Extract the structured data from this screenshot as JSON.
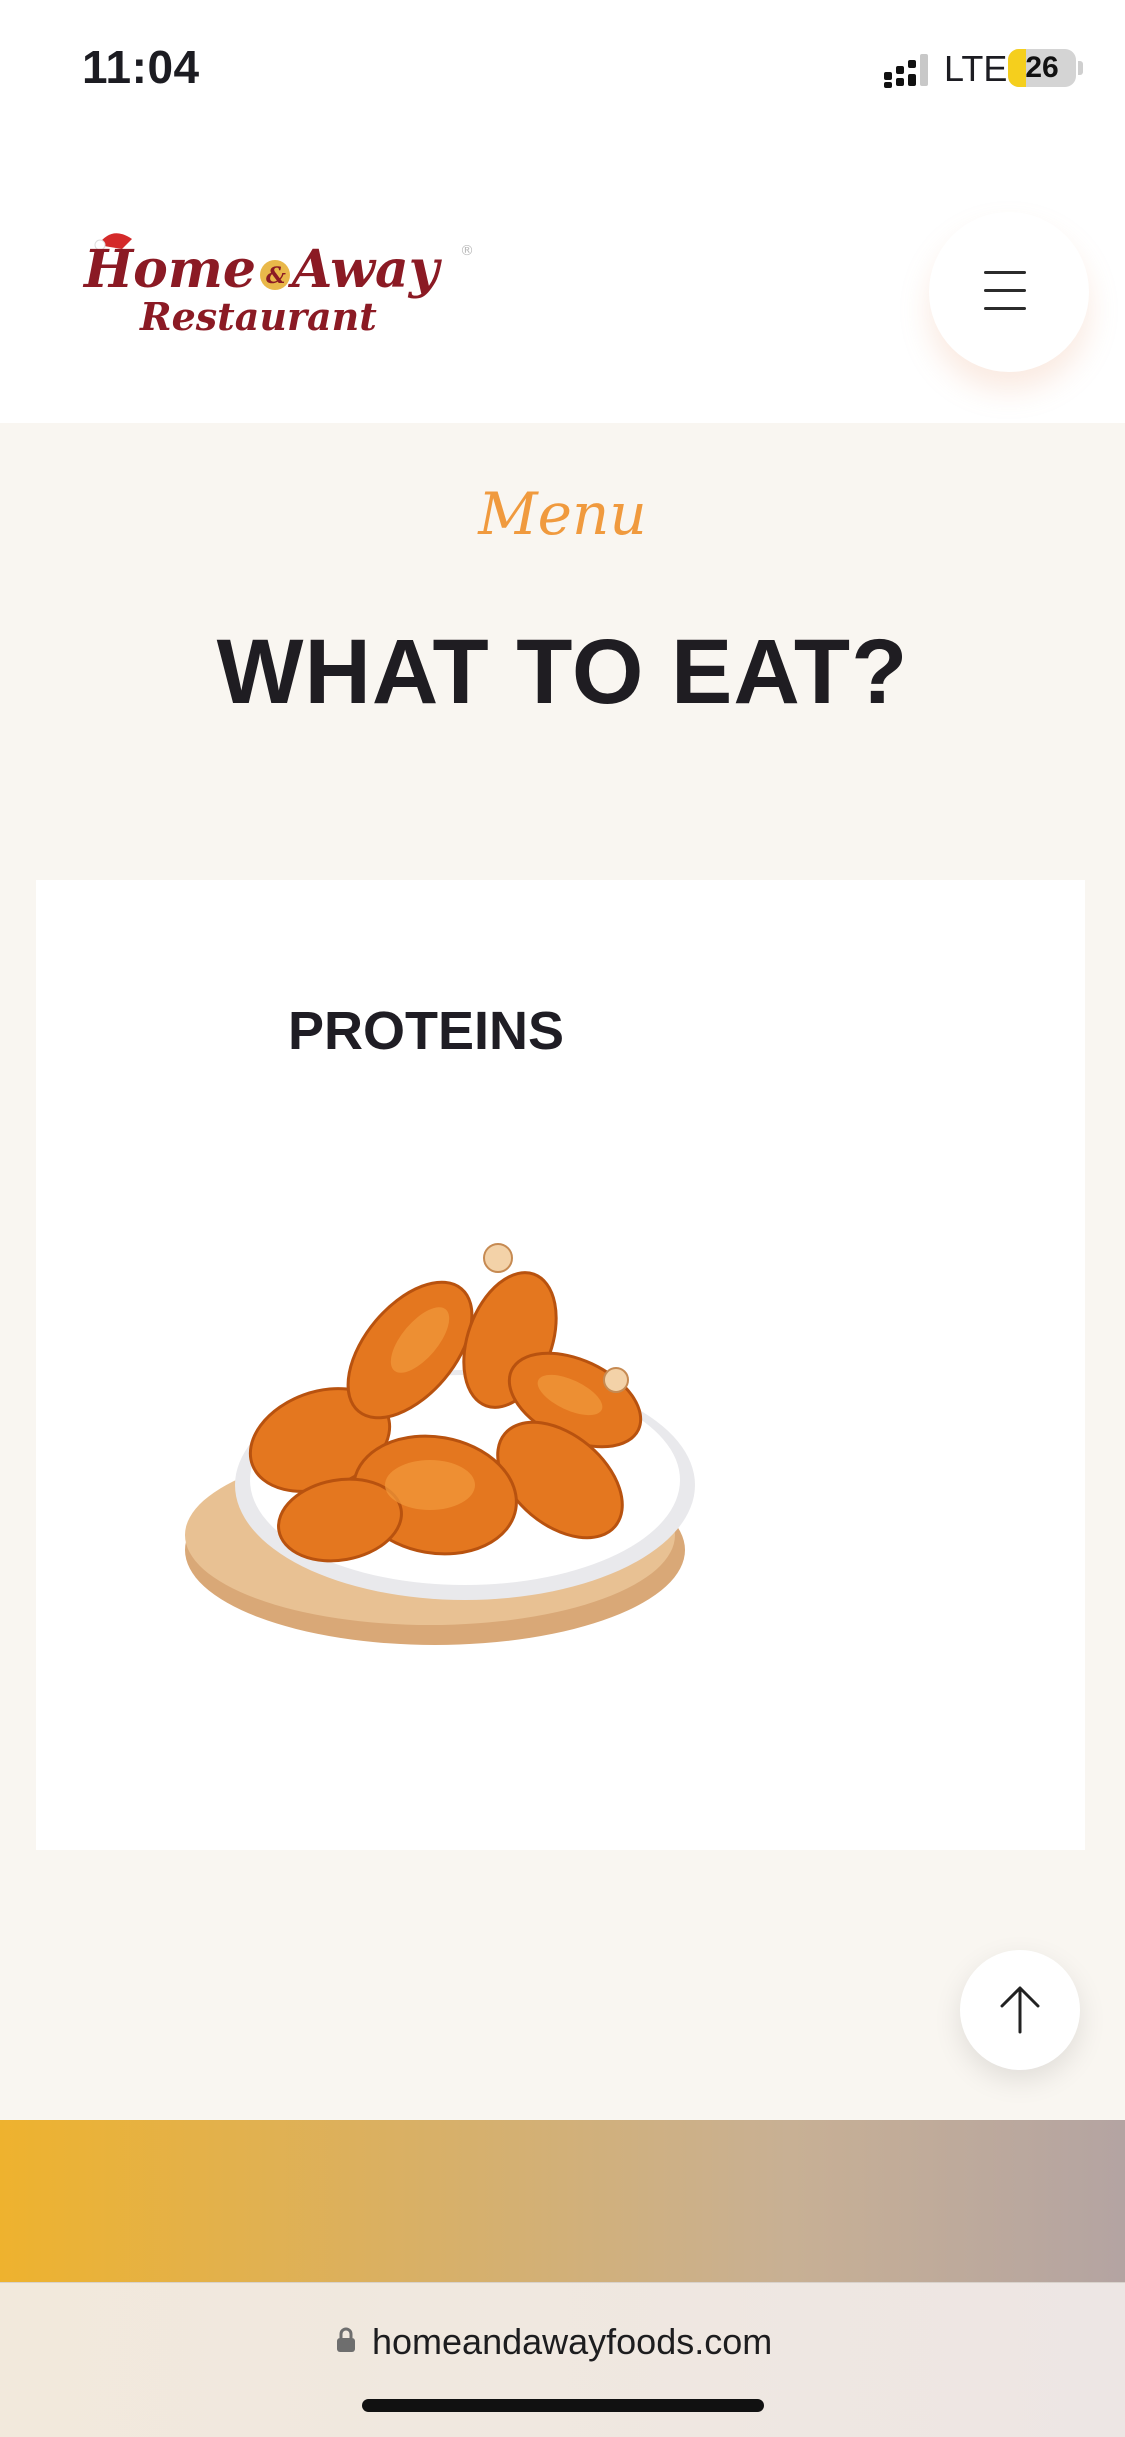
{
  "status_bar": {
    "time": "11:04",
    "network": "LTE",
    "battery": "26",
    "battery_level": 0.26
  },
  "header": {
    "logo": {
      "line1_a": "Home",
      "line1_amp": "&",
      "line1_b": "Away",
      "line2": "Restaurant",
      "registered": "®"
    },
    "menu_icon": "hamburger-icon"
  },
  "menu_section": {
    "eyebrow": "Menu",
    "title": "WHAT TO EAT?"
  },
  "card": {
    "title": "PROTEINS",
    "image": "fried-chicken-plate"
  },
  "back_to_top_icon": "arrow-up-icon",
  "browser": {
    "url": "homeandawayfoods.com",
    "lock_icon": "lock-icon"
  },
  "colors": {
    "accent": "#f09a3e",
    "brand": "#8b1a24",
    "background": "#f9f6f1",
    "heading": "#1f1d22"
  }
}
